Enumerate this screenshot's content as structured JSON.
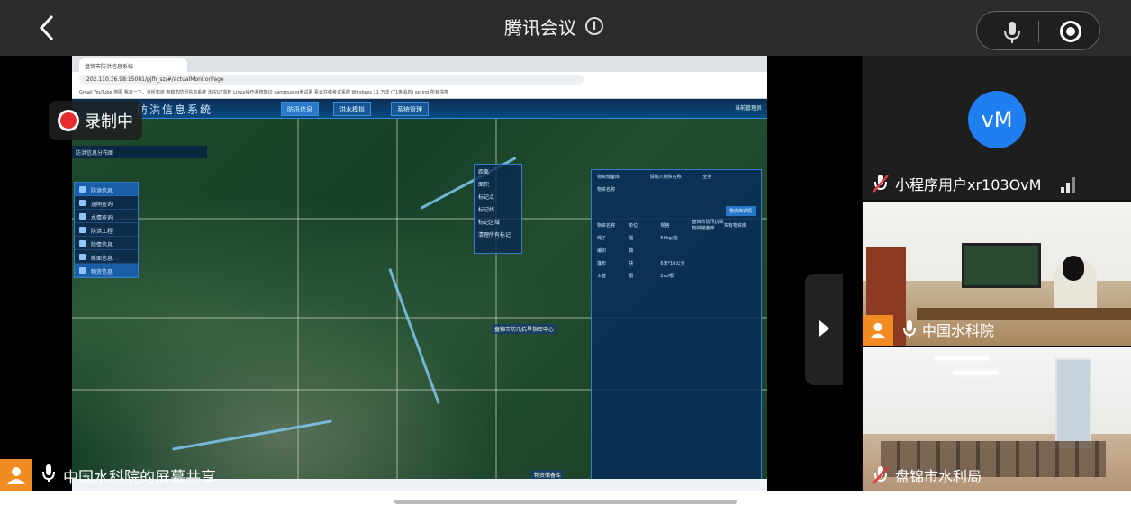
{
  "topbar": {
    "title": "腾讯会议"
  },
  "recording": {
    "label": "录制中"
  },
  "share": {
    "label": "中国水科院的屏幕共享"
  },
  "browser": {
    "tab_title": "盘锦市防洪信息系统",
    "url": "202.110.36.98:15081/pjfh_sz/#/actualMonitorPage",
    "bookmarks": "Gmail  YouTube  地图  我来一下，分析知道  盘锦市防汛信息系统  淘宝UT资料  Linux操作系统知识  yangguang考试系  看云在线考试系统  Windows 11 方法  (71条消息) spring  所有书签"
  },
  "app": {
    "title": "防洪信息系统",
    "nav": [
      "防汛信息",
      "洪水模拟",
      "系统管理"
    ],
    "user": "当前管理员",
    "map_header": "防洪信息分布图",
    "sidebar": [
      "防洪信息",
      "涵闸查询",
      "水情查询",
      "防洪工程",
      "险情信息",
      "断面信息",
      "物资信息"
    ],
    "layer_tools": [
      "距离",
      "面积",
      "标记点",
      "标记线",
      "标记区域",
      "清理所有标记"
    ],
    "panel": {
      "search_placeholder": "请输入物资名称",
      "filter_label": "全类",
      "button": "物资库详情",
      "columns": [
        "物资名称",
        "单位",
        "规格",
        "盘锦市防汛抗旱物资储备库",
        "实有物资库"
      ],
      "rows": [
        [
          "绳子",
          "捆",
          "50kg/捆",
          "",
          ""
        ],
        [
          "编织",
          "袋",
          "",
          "",
          ""
        ],
        [
          "篷布",
          "块",
          "6米*10公分",
          "",
          ""
        ],
        [
          "木桩",
          "根",
          "2m/根",
          "",
          ""
        ]
      ],
      "labels": [
        "物资储备库",
        "物资名称"
      ]
    },
    "marker": "盘锦市防汛抗旱指挥中心",
    "footer_label": "物资储备库"
  },
  "tiles": [
    {
      "name": "小程序用户xr103OvM",
      "initials": "vM"
    },
    {
      "name": "中国水科院"
    },
    {
      "name": "盘锦市水利局"
    }
  ]
}
